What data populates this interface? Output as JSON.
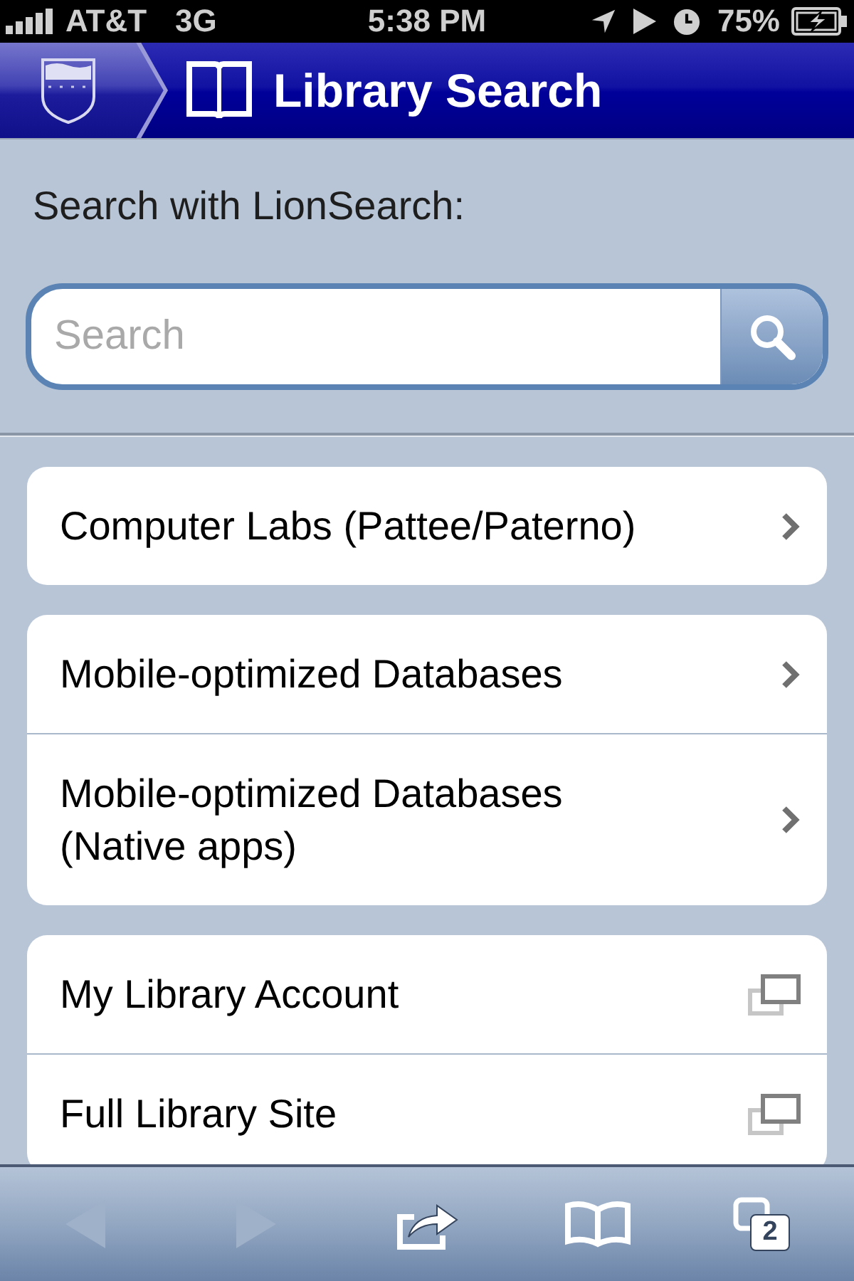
{
  "status_bar": {
    "carrier": "AT&T",
    "network": "3G",
    "time": "5:38 PM",
    "battery": "75%"
  },
  "header": {
    "title": "Library Search"
  },
  "search": {
    "label": "Search with LionSearch:",
    "placeholder": "Search"
  },
  "groups": [
    {
      "items": [
        {
          "label": "Computer Labs (Pattee/Paterno)",
          "kind": "link"
        }
      ]
    },
    {
      "items": [
        {
          "label": "Mobile-optimized Databases",
          "kind": "link"
        },
        {
          "label": "Mobile-optimized Databases (Native apps)",
          "kind": "link"
        }
      ]
    },
    {
      "items": [
        {
          "label": "My Library Account",
          "kind": "external"
        },
        {
          "label": "Full Library Site",
          "kind": "external"
        }
      ]
    }
  ],
  "toolbar": [
    {
      "kind": "back",
      "disabled": true
    },
    {
      "kind": "forward",
      "disabled": true
    },
    {
      "kind": "share",
      "disabled": false
    },
    {
      "kind": "bookmarks",
      "disabled": false
    },
    {
      "kind": "tabs",
      "disabled": false,
      "count": "2"
    }
  ]
}
